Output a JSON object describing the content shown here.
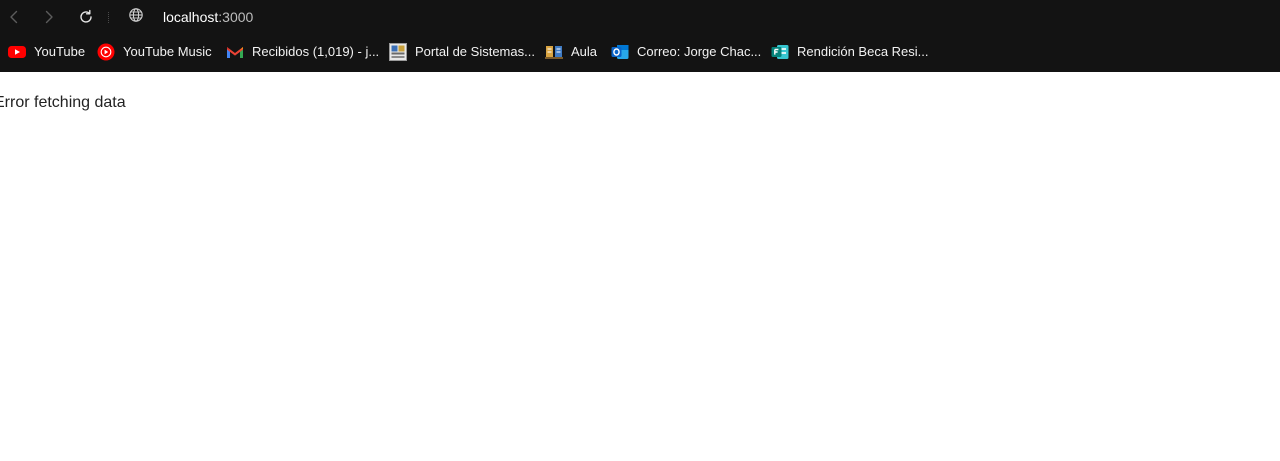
{
  "browser": {
    "address": {
      "host": "localhost",
      "port": ":3000"
    },
    "nav_icons": [
      "back-arrow-icon",
      "forward-arrow-icon",
      "reload-icon",
      "globe-icon"
    ],
    "bookmarks": [
      {
        "label": "YouTube",
        "icon": "youtube-icon",
        "color": "#ff0000"
      },
      {
        "label": "YouTube Music",
        "icon": "youtube-music-icon",
        "color": "#ff0000"
      },
      {
        "label": "Recibidos (1,019) - j...",
        "icon": "gmail-icon",
        "color": "#ea4335"
      },
      {
        "label": "Portal de Sistemas...",
        "icon": "portal-icon",
        "color": "#d8d8d8"
      },
      {
        "label": "Aula",
        "icon": "aula-icon",
        "color": "#d9a441"
      },
      {
        "label": "Correo: Jorge Chac...",
        "icon": "outlook-icon",
        "color": "#0a64c8"
      },
      {
        "label": "Rendición Beca Resi...",
        "icon": "forms-icon",
        "color": "#05837b"
      }
    ]
  },
  "page": {
    "error_message": "Error fetching data"
  }
}
